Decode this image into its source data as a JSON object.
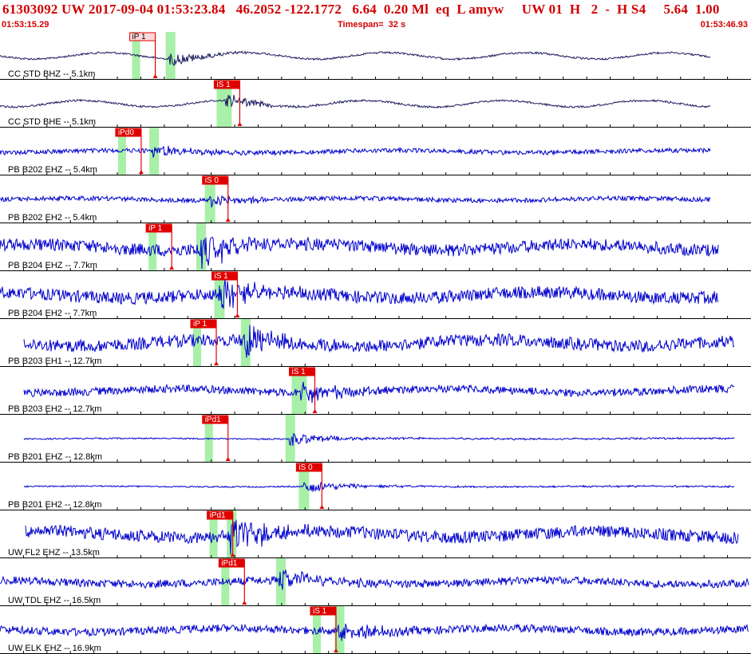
{
  "header": {
    "title": "61303092 UW 2017-09-04 01:53:23.84   46.2052 -122.1772   6.64  0.20 Ml  eq  L amyw     UW 01  H   2  -  H S4     5.64  1.00",
    "start_time": "01:53:15.29",
    "timespan": "Timespan=  32 s",
    "end_time": "01:53:46.93"
  },
  "colors": {
    "header_text": "#d00000",
    "trace_std": "#1a1a5e",
    "trace_blue": "#0000cc",
    "pick_red": "#e00000",
    "pick_pink": "#ffd8d8",
    "window_green": "#a8f0a8",
    "separator": "#000000"
  },
  "traces": [
    {
      "label": "CC STD BHZ -- 5.1km",
      "pick": "iP 1",
      "pick_style": "outline",
      "amplitude": "low",
      "onset_t": 7.2,
      "pick_t": 5.8
    },
    {
      "label": "CC STD BHE -- 5.1km",
      "pick": "iS 1",
      "pick_style": "filled",
      "amplitude": "low",
      "onset_t": 9.6,
      "pick_t": 9.4
    },
    {
      "label": "PB B202 EHZ -- 5.4km",
      "pick": "iPd0",
      "pick_style": "filled",
      "amplitude": "low",
      "onset_t": 6.5,
      "pick_t": 5.2
    },
    {
      "label": "PB B202 EH2 -- 5.4km",
      "pick": "iS 0",
      "pick_style": "filled",
      "amplitude": "low",
      "onset_t": 8.9,
      "pick_t": 8.9
    },
    {
      "label": "PB B204 EHZ -- 7.7km",
      "pick": "iP 1",
      "pick_style": "filled",
      "amplitude": "high",
      "onset_t": 8.5,
      "pick_t": 6.5
    },
    {
      "label": "PB B204 EH2 -- 7.7km",
      "pick": "iS 1",
      "pick_style": "filled",
      "amplitude": "high",
      "onset_t": 9.3,
      "pick_t": 9.3
    },
    {
      "label": "PB B203 EH1 -- 12.7km",
      "pick": "iP 1",
      "pick_style": "filled",
      "amplitude": "high",
      "onset_t": 10.4,
      "pick_t": 8.4
    },
    {
      "label": "PB B203 EH2 -- 12.7km",
      "pick": "iS 1",
      "pick_style": "filled",
      "amplitude": "mid",
      "onset_t": 12.8,
      "pick_t": 12.6
    },
    {
      "label": "PB B201 EHZ -- 12.8km",
      "pick": "iPd1",
      "pick_style": "filled",
      "amplitude": "flat",
      "onset_t": 12.3,
      "pick_t": 8.9
    },
    {
      "label": "PB B201 EH2 -- 12.8km",
      "pick": "iS 0",
      "pick_style": "filled",
      "amplitude": "flat",
      "onset_t": 12.9,
      "pick_t": 12.9
    },
    {
      "label": "UW FL2 EHZ -- 13.5km",
      "pick": "iPd1",
      "pick_style": "filled",
      "amplitude": "high",
      "onset_t": 9.8,
      "pick_t": 9.1
    },
    {
      "label": "UW TDL EHZ -- 16.5km",
      "pick": "iPd1",
      "pick_style": "filled",
      "amplitude": "mid",
      "onset_t": 11.9,
      "pick_t": 9.6
    },
    {
      "label": "UW ELK EHZ -- 16.9km",
      "pick": "iS 1",
      "pick_style": "filled",
      "amplitude": "mid",
      "onset_t": 14.4,
      "pick_t": 13.5
    }
  ]
}
